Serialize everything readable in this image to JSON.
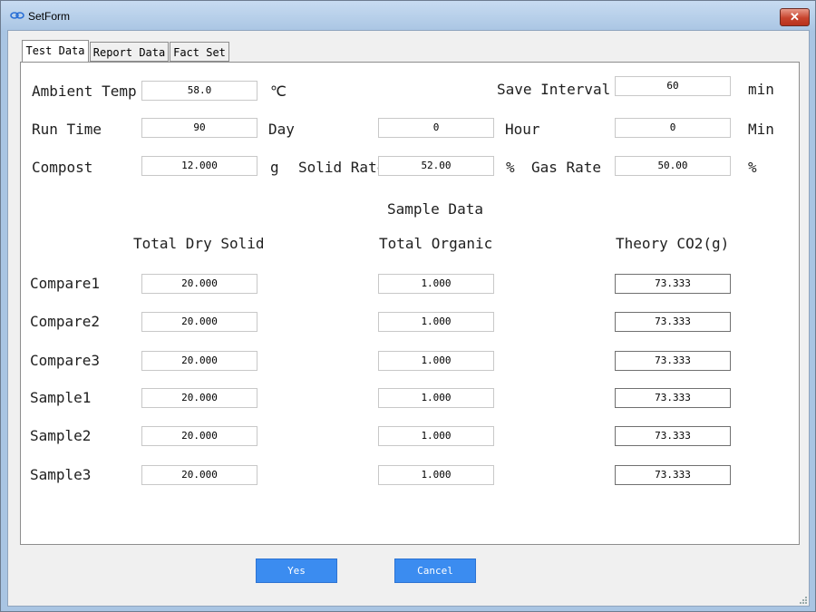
{
  "window": {
    "title": "SetForm",
    "close_glyph": "✕"
  },
  "tabs": [
    {
      "label": "Test Data",
      "active": true
    },
    {
      "label": "Report Data",
      "active": false
    },
    {
      "label": "Fact Set",
      "active": false
    }
  ],
  "settings": {
    "ambient_temp": {
      "label": "Ambient Temp",
      "value": "58.0",
      "unit": "℃"
    },
    "save_interval": {
      "label": "Save Interval",
      "value": "60",
      "unit": "min"
    },
    "run_time": {
      "label": "Run Time",
      "day_value": "90",
      "day_unit": "Day",
      "hour_value": "0",
      "hour_unit": "Hour",
      "min_value": "0",
      "min_unit": "Min"
    },
    "compost": {
      "label": "Compost",
      "value": "12.000",
      "unit": "g"
    },
    "solid_rate": {
      "label": "Solid Rate",
      "value": "52.00",
      "unit": "%"
    },
    "gas_rate": {
      "label": "Gas Rate",
      "value": "50.00",
      "unit": "%"
    }
  },
  "sample_data": {
    "heading": "Sample Data",
    "columns": [
      "Total Dry Solid",
      "Total Organic",
      "Theory CO2(g)"
    ],
    "rows": [
      {
        "name": "Compare1",
        "dry_solid": "20.000",
        "organic": "1.000",
        "co2": "73.333"
      },
      {
        "name": "Compare2",
        "dry_solid": "20.000",
        "organic": "1.000",
        "co2": "73.333"
      },
      {
        "name": "Compare3",
        "dry_solid": "20.000",
        "organic": "1.000",
        "co2": "73.333"
      },
      {
        "name": "Sample1",
        "dry_solid": "20.000",
        "organic": "1.000",
        "co2": "73.333"
      },
      {
        "name": "Sample2",
        "dry_solid": "20.000",
        "organic": "1.000",
        "co2": "73.333"
      },
      {
        "name": "Sample3",
        "dry_solid": "20.000",
        "organic": "1.000",
        "co2": "73.333"
      }
    ]
  },
  "buttons": {
    "yes": "Yes",
    "cancel": "Cancel"
  },
  "colors": {
    "title_bar": "#a9c5e3",
    "button_blue": "#3b8cf0",
    "close_red": "#c7432d"
  }
}
